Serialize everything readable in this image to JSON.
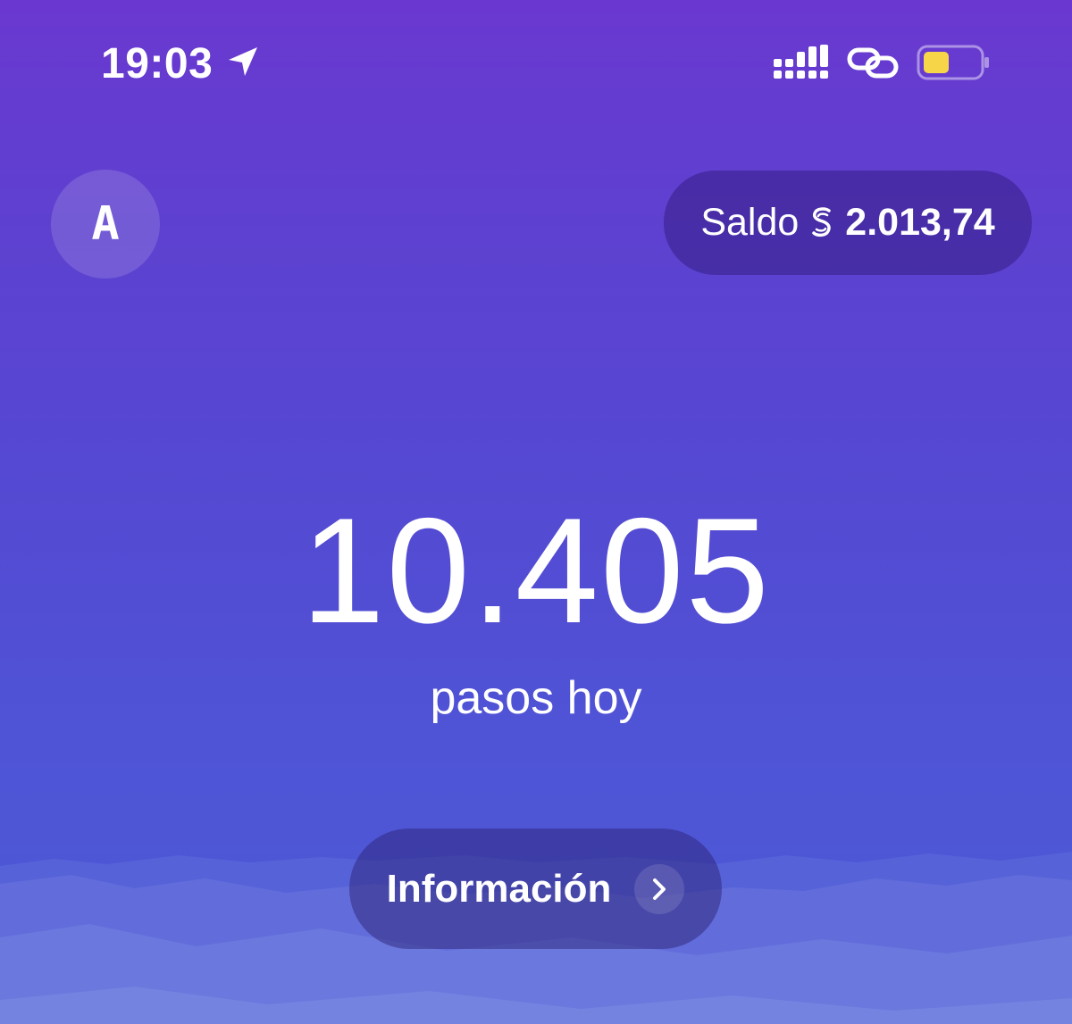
{
  "status_bar": {
    "time": "19:03",
    "icons": [
      "location-arrow-icon",
      "signal-icon",
      "link-icon",
      "battery-icon"
    ],
    "battery_color": "#f7d548"
  },
  "header": {
    "avatar_initial": "A",
    "balance_label": "Saldo",
    "balance_currency_icon": "sweatcoin-icon",
    "balance_amount": "2.013,74"
  },
  "main": {
    "steps_value": "10.405",
    "steps_caption": "pasos hoy",
    "info_button_label": "Información",
    "info_button_icon": "chevron-right-icon"
  },
  "colors": {
    "background_top": "#6a38d0",
    "background_bottom": "#4b5bd7",
    "text": "#ffffff"
  }
}
